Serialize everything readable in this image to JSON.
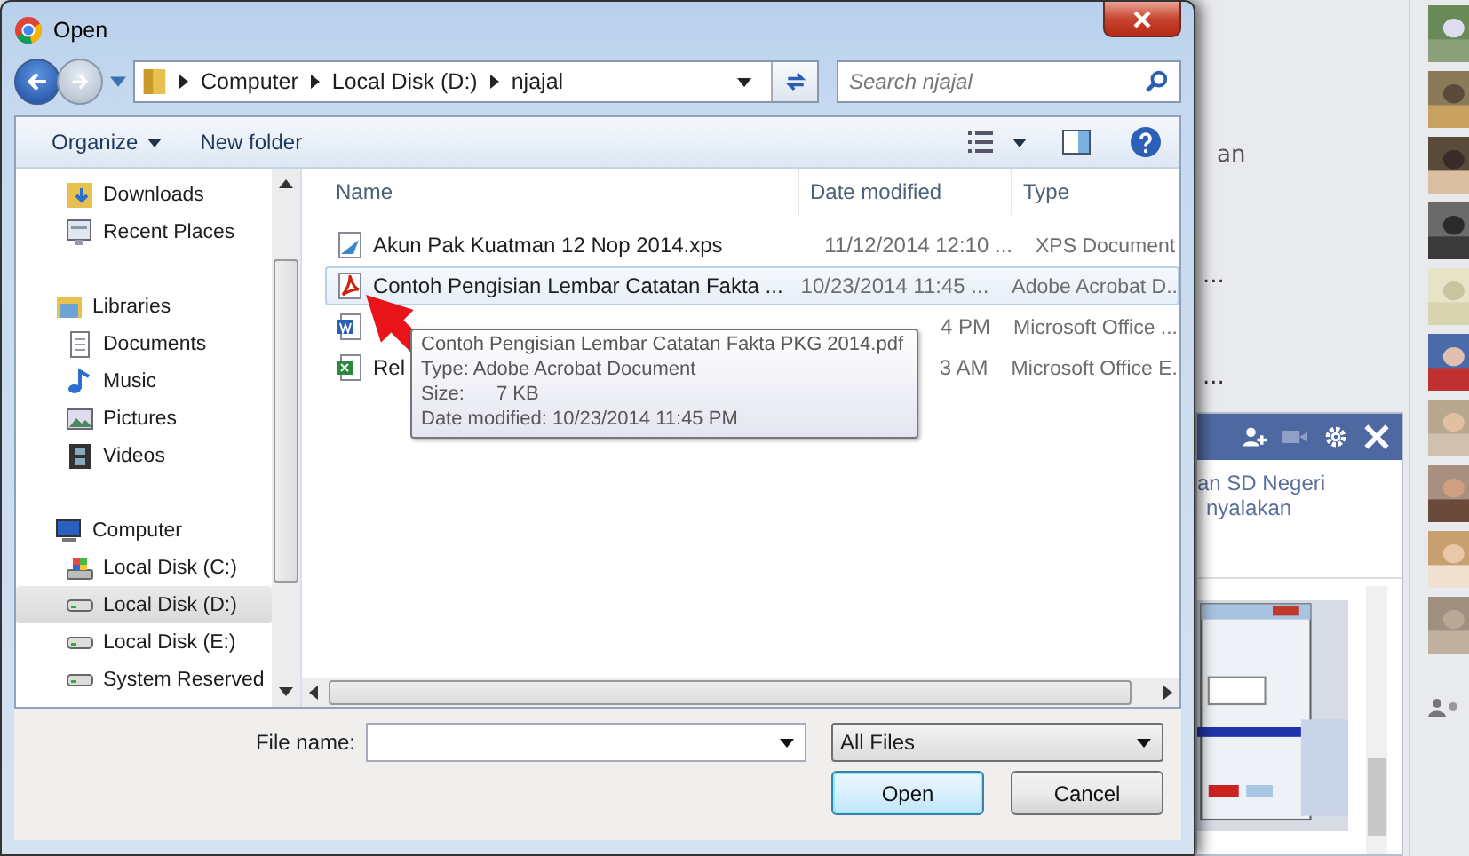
{
  "window": {
    "title": "Open"
  },
  "address": {
    "segments": [
      "Computer",
      "Local Disk (D:)",
      "njajal"
    ]
  },
  "search": {
    "placeholder": "Search njajal"
  },
  "toolbar": {
    "buttons": [
      "Organize",
      "New folder"
    ]
  },
  "sidebar": {
    "sections": [
      {
        "children": [
          {
            "label": "Downloads",
            "kind": "downloads",
            "selected": false
          },
          {
            "label": "Recent Places",
            "kind": "recent",
            "selected": false
          }
        ]
      },
      {
        "label": "Libraries",
        "kind": "library",
        "children": [
          {
            "label": "Documents",
            "kind": "documents",
            "selected": false
          },
          {
            "label": "Music",
            "kind": "music",
            "selected": false
          },
          {
            "label": "Pictures",
            "kind": "pictures",
            "selected": false
          },
          {
            "label": "Videos",
            "kind": "videos",
            "selected": false
          }
        ]
      },
      {
        "label": "Computer",
        "kind": "computer",
        "children": [
          {
            "label": "Local Disk (C:)",
            "kind": "system-disk",
            "selected": false
          },
          {
            "label": "Local Disk (D:)",
            "kind": "disk",
            "selected": true
          },
          {
            "label": "Local Disk (E:)",
            "kind": "disk",
            "selected": false
          },
          {
            "label": "System Reserved",
            "kind": "disk",
            "selected": false
          }
        ]
      }
    ]
  },
  "files": {
    "columns": [
      "Name",
      "Date modified",
      "Type"
    ],
    "rows": [
      {
        "name": "Akun Pak Kuatman 12 Nop 2014.xps",
        "date": "11/12/2014 12:10 ...",
        "type": "XPS Document",
        "kind": "xps",
        "selected": false
      },
      {
        "name": "Contoh Pengisian Lembar Catatan Fakta ...",
        "date": "10/23/2014 11:45 ...",
        "type": "Adobe Acrobat D..",
        "kind": "pdf",
        "selected": true
      },
      {
        "date": "4 PM",
        "type": "Microsoft Office ...",
        "kind": "word",
        "selected": false
      },
      {
        "name": "Rel",
        "date": "3 AM",
        "type": "Microsoft Office E.",
        "kind": "excel",
        "selected": false
      }
    ]
  },
  "tooltip": {
    "name": "Contoh Pengisian Lembar Catatan Fakta PKG 2014.pdf",
    "type": "Type: Adobe Acrobat Document",
    "size_label": "Size:",
    "size_value": "7 KB",
    "modified": "Date modified: 10/23/2014 11:45 PM"
  },
  "footer": {
    "file_name_label": "File name:",
    "filter": "All Files",
    "buttons": [
      "Open",
      "Cancel"
    ]
  },
  "background": {
    "texts": [
      "an",
      "...",
      "..."
    ],
    "chat": {
      "lines": [
        "an SD Negeri",
        "nyalakan"
      ]
    }
  }
}
